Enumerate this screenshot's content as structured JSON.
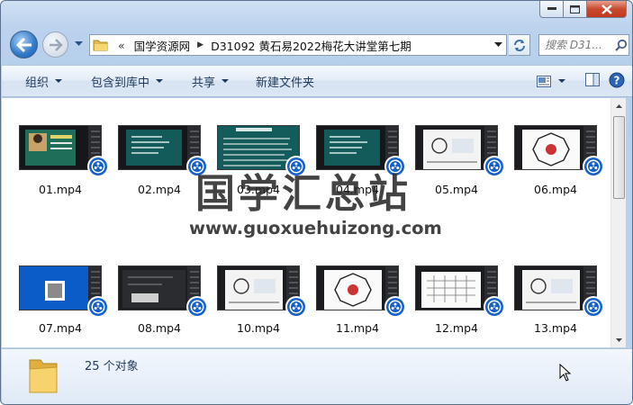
{
  "window": {
    "controls": {
      "minimize": "minimize-icon",
      "maximize": "maximize-icon",
      "close": "close-icon"
    }
  },
  "nav": {
    "address": {
      "overflow": "«",
      "crumbs": [
        "国学资源网",
        "D31092 黄石易2022梅花大讲堂第七期"
      ]
    },
    "search_placeholder": "搜索 D31..."
  },
  "toolbar": {
    "organize": "组织",
    "include_in_library": "包含到库中",
    "share": "共享",
    "new_folder": "新建文件夹"
  },
  "files": [
    {
      "name": "01.mp4",
      "thumb": "person"
    },
    {
      "name": "02.mp4",
      "thumb": "board"
    },
    {
      "name": "03.mp4",
      "thumb": "board-tall"
    },
    {
      "name": "04.mp4",
      "thumb": "board"
    },
    {
      "name": "05.mp4",
      "thumb": "diagram"
    },
    {
      "name": "06.mp4",
      "thumb": "bagua"
    },
    {
      "name": "07.mp4",
      "thumb": "desktop"
    },
    {
      "name": "08.mp4",
      "thumb": "dark"
    },
    {
      "name": "10.mp4",
      "thumb": "diagram"
    },
    {
      "name": "11.mp4",
      "thumb": "bagua"
    },
    {
      "name": "12.mp4",
      "thumb": "grid"
    },
    {
      "name": "13.mp4",
      "thumb": "diagram"
    }
  ],
  "watermark": {
    "title": "国学汇总站",
    "url": "www.guoxuehuizong.com"
  },
  "details": {
    "count": "25 个对象"
  },
  "colors": {
    "accent": "#1e395b",
    "badge": "#1560c9"
  }
}
